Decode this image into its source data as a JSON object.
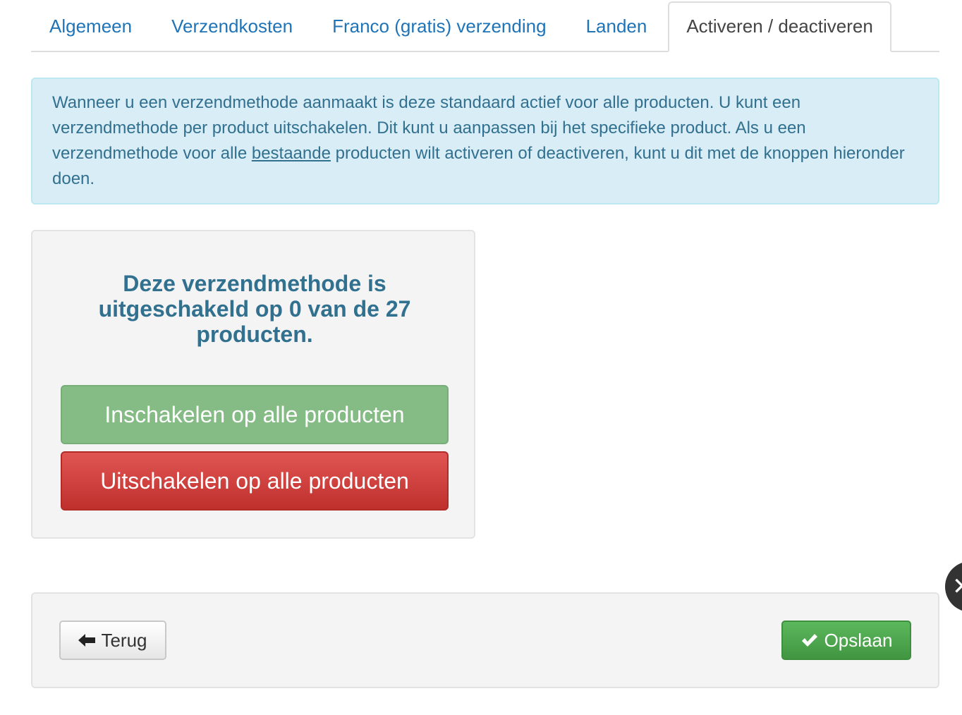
{
  "tabs": [
    {
      "label": "Algemeen",
      "active": false
    },
    {
      "label": "Verzendkosten",
      "active": false
    },
    {
      "label": "Franco (gratis) verzending",
      "active": false
    },
    {
      "label": "Landen",
      "active": false
    },
    {
      "label": "Activeren / deactiveren",
      "active": true
    }
  ],
  "info": {
    "text_before": "Wanneer u een verzendmethode aanmaakt is deze standaard actief voor alle producten. U kunt een verzendmethode per product uitschakelen. Dit kunt u aanpassen bij het specifieke product. Als u een verzendmethode voor alle ",
    "underlined": "bestaande",
    "text_after": " producten wilt activeren of deactiveren, kunt u dit met de knoppen hieronder doen."
  },
  "status": {
    "heading": "Deze verzendmethode is uitgeschakeld op 0 van de 27 producten.",
    "enable_label": "Inschakelen op alle producten",
    "disable_label": "Uitschakelen op alle producten"
  },
  "footer": {
    "back_label": "Terug",
    "save_label": "Opslaan"
  },
  "icons": {
    "back": "arrow-left-icon",
    "save": "checkmark-icon",
    "close": "close-icon"
  },
  "colors": {
    "link": "#1f74b8",
    "info_bg": "#d9edf7",
    "info_text": "#31708f",
    "enable_green": "#85bb85",
    "disable_red": "#c9302c",
    "save_green": "#4cae4c"
  }
}
